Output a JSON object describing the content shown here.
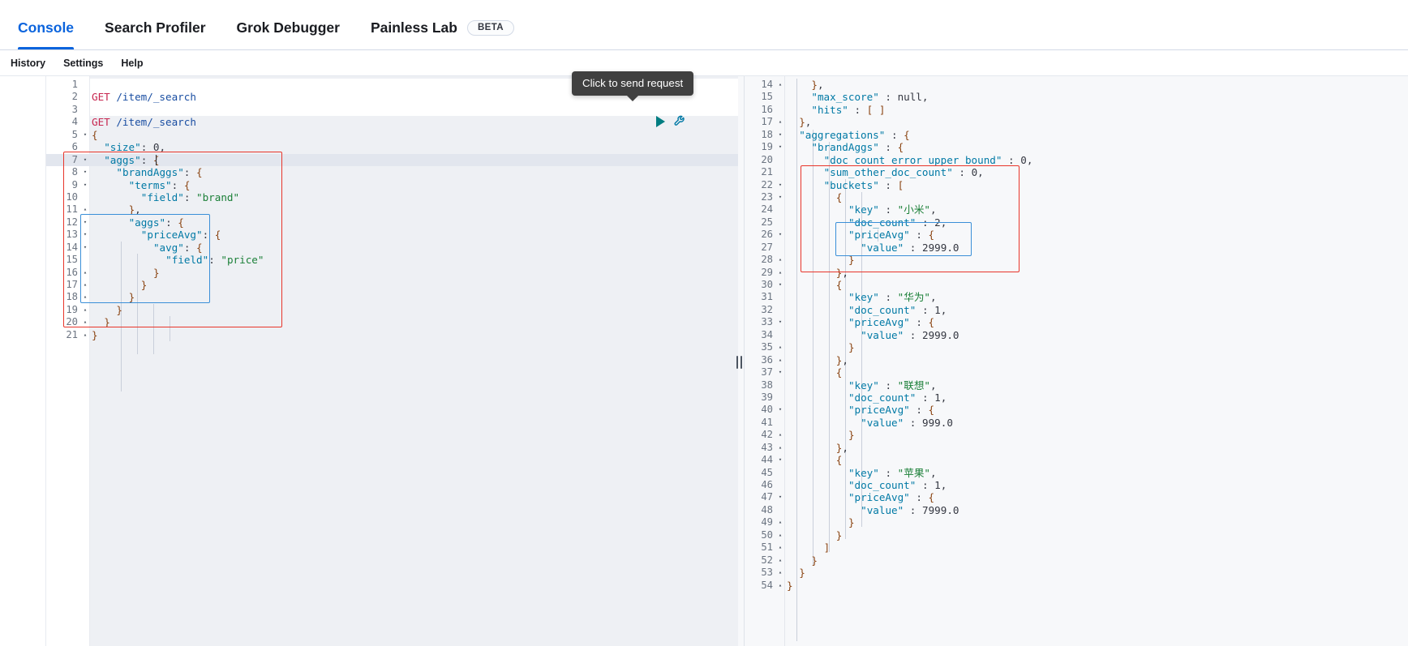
{
  "tabs": [
    {
      "label": "Console",
      "active": true,
      "badge": null
    },
    {
      "label": "Search Profiler",
      "active": false,
      "badge": null
    },
    {
      "label": "Grok Debugger",
      "active": false,
      "badge": null
    },
    {
      "label": "Painless Lab",
      "active": false,
      "badge": "BETA"
    }
  ],
  "submenu": [
    {
      "label": "History"
    },
    {
      "label": "Settings"
    },
    {
      "label": "Help"
    }
  ],
  "tooltip": {
    "text": "Click to send request"
  },
  "icons": {
    "play": "play-icon",
    "wrench": "wrench-icon",
    "resize": "resize-handle-icon"
  },
  "colors": {
    "accent": "#0b64dd",
    "play": "#007d81",
    "wrench": "#0079a5",
    "annotation_red": "#e8352a",
    "annotation_blue": "#3a8fd8",
    "method": "#c7254e",
    "key": "#0079a5",
    "string": "#1a7f37",
    "tooltip_bg": "#404040"
  },
  "editor": {
    "name": "request-editor",
    "active_line": 7,
    "lines": [
      {
        "n": 1,
        "fold": "",
        "text": ""
      },
      {
        "n": 2,
        "fold": "",
        "text": "GET /item/_search"
      },
      {
        "n": 3,
        "fold": "",
        "text": ""
      },
      {
        "n": 4,
        "fold": "",
        "text": "GET /item/_search"
      },
      {
        "n": 5,
        "fold": "▾",
        "text": "{"
      },
      {
        "n": 6,
        "fold": "",
        "text": "  \"size\": 0,"
      },
      {
        "n": 7,
        "fold": "▾",
        "text": "  \"aggs\": {"
      },
      {
        "n": 8,
        "fold": "▾",
        "text": "    \"brandAggs\": {"
      },
      {
        "n": 9,
        "fold": "▾",
        "text": "      \"terms\": {"
      },
      {
        "n": 10,
        "fold": "",
        "text": "        \"field\": \"brand\""
      },
      {
        "n": 11,
        "fold": "▴",
        "text": "      },"
      },
      {
        "n": 12,
        "fold": "▾",
        "text": "      \"aggs\": {"
      },
      {
        "n": 13,
        "fold": "▾",
        "text": "        \"priceAvg\": {"
      },
      {
        "n": 14,
        "fold": "▾",
        "text": "          \"avg\": {"
      },
      {
        "n": 15,
        "fold": "",
        "text": "            \"field\": \"price\""
      },
      {
        "n": 16,
        "fold": "▴",
        "text": "          }"
      },
      {
        "n": 17,
        "fold": "▴",
        "text": "        }"
      },
      {
        "n": 18,
        "fold": "▴",
        "text": "      }"
      },
      {
        "n": 19,
        "fold": "▴",
        "text": "    }"
      },
      {
        "n": 20,
        "fold": "▴",
        "text": "  }"
      },
      {
        "n": 21,
        "fold": "▴",
        "text": "}"
      }
    ]
  },
  "response": {
    "name": "response-viewer",
    "lines": [
      {
        "n": 14,
        "fold": "▴",
        "text": "    },"
      },
      {
        "n": 15,
        "fold": "",
        "text": "    \"max_score\" : null,"
      },
      {
        "n": 16,
        "fold": "",
        "text": "    \"hits\" : [ ]"
      },
      {
        "n": 17,
        "fold": "▴",
        "text": "  },"
      },
      {
        "n": 18,
        "fold": "▾",
        "text": "  \"aggregations\" : {"
      },
      {
        "n": 19,
        "fold": "▾",
        "text": "    \"brandAggs\" : {"
      },
      {
        "n": 20,
        "fold": "",
        "text": "      \"doc_count_error_upper_bound\" : 0,"
      },
      {
        "n": 21,
        "fold": "",
        "text": "      \"sum_other_doc_count\" : 0,"
      },
      {
        "n": 22,
        "fold": "▾",
        "text": "      \"buckets\" : ["
      },
      {
        "n": 23,
        "fold": "▾",
        "text": "        {"
      },
      {
        "n": 24,
        "fold": "",
        "text": "          \"key\" : \"小米\","
      },
      {
        "n": 25,
        "fold": "",
        "text": "          \"doc_count\" : 2,"
      },
      {
        "n": 26,
        "fold": "▾",
        "text": "          \"priceAvg\" : {"
      },
      {
        "n": 27,
        "fold": "",
        "text": "            \"value\" : 2999.0"
      },
      {
        "n": 28,
        "fold": "▴",
        "text": "          }"
      },
      {
        "n": 29,
        "fold": "▴",
        "text": "        },"
      },
      {
        "n": 30,
        "fold": "▾",
        "text": "        {"
      },
      {
        "n": 31,
        "fold": "",
        "text": "          \"key\" : \"华为\","
      },
      {
        "n": 32,
        "fold": "",
        "text": "          \"doc_count\" : 1,"
      },
      {
        "n": 33,
        "fold": "▾",
        "text": "          \"priceAvg\" : {"
      },
      {
        "n": 34,
        "fold": "",
        "text": "            \"value\" : 2999.0"
      },
      {
        "n": 35,
        "fold": "▴",
        "text": "          }"
      },
      {
        "n": 36,
        "fold": "▴",
        "text": "        },"
      },
      {
        "n": 37,
        "fold": "▾",
        "text": "        {"
      },
      {
        "n": 38,
        "fold": "",
        "text": "          \"key\" : \"联想\","
      },
      {
        "n": 39,
        "fold": "",
        "text": "          \"doc_count\" : 1,"
      },
      {
        "n": 40,
        "fold": "▾",
        "text": "          \"priceAvg\" : {"
      },
      {
        "n": 41,
        "fold": "",
        "text": "            \"value\" : 999.0"
      },
      {
        "n": 42,
        "fold": "▴",
        "text": "          }"
      },
      {
        "n": 43,
        "fold": "▴",
        "text": "        },"
      },
      {
        "n": 44,
        "fold": "▾",
        "text": "        {"
      },
      {
        "n": 45,
        "fold": "",
        "text": "          \"key\" : \"苹果\","
      },
      {
        "n": 46,
        "fold": "",
        "text": "          \"doc_count\" : 1,"
      },
      {
        "n": 47,
        "fold": "▾",
        "text": "          \"priceAvg\" : {"
      },
      {
        "n": 48,
        "fold": "",
        "text": "            \"value\" : 7999.0"
      },
      {
        "n": 49,
        "fold": "▴",
        "text": "          }"
      },
      {
        "n": 50,
        "fold": "▴",
        "text": "        }"
      },
      {
        "n": 51,
        "fold": "▴",
        "text": "      ]"
      },
      {
        "n": 52,
        "fold": "▴",
        "text": "    }"
      },
      {
        "n": 53,
        "fold": "▴",
        "text": "  }"
      },
      {
        "n": 54,
        "fold": "▴",
        "text": "}"
      }
    ]
  },
  "aggregation_result": {
    "doc_count_error_upper_bound": 0,
    "sum_other_doc_count": 0,
    "buckets": [
      {
        "key": "小米",
        "doc_count": 2,
        "priceAvg": 2999.0
      },
      {
        "key": "华为",
        "doc_count": 1,
        "priceAvg": 2999.0
      },
      {
        "key": "联想",
        "doc_count": 1,
        "priceAvg": 999.0
      },
      {
        "key": "苹果",
        "doc_count": 1,
        "priceAvg": 7999.0
      }
    ],
    "max_score": null,
    "hits": []
  }
}
